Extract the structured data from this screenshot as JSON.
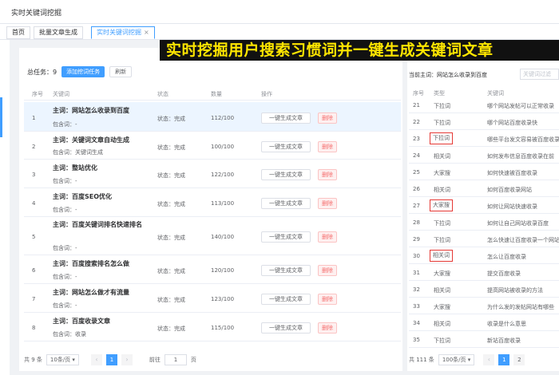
{
  "window_title": "实时关键词挖掘",
  "tabs": [
    {
      "label": "首页"
    },
    {
      "label": "批量文章生成"
    },
    {
      "label": "实时关键词挖掘",
      "close": "×"
    }
  ],
  "banner": "实时挖掘用户搜索习惯词并一键生成关键词文章",
  "toolbar": {
    "total_label": "总任务：",
    "total_count": "9",
    "add_button": "添加挖词任务",
    "refresh_button": "刷新"
  },
  "task_table": {
    "headers": [
      "序号",
      "关键词",
      "状态",
      "数量",
      "操作"
    ],
    "rows": [
      {
        "idx": "1",
        "keyword": "主词：网站怎么收录到百度",
        "include": "包含词：-",
        "status": "状态：完成",
        "count": "112/100",
        "gen": "一键生成文章",
        "del": "删除",
        "selected": true
      },
      {
        "idx": "2",
        "keyword": "主词：关键词文章自动生成",
        "include": "包含词：关键词生成",
        "status": "状态：完成",
        "count": "100/100",
        "gen": "一键生成文章",
        "del": "删除"
      },
      {
        "idx": "3",
        "keyword": "主词：整站优化",
        "include": "包含词：-",
        "status": "状态：完成",
        "count": "122/100",
        "gen": "一键生成文章",
        "del": "删除"
      },
      {
        "idx": "4",
        "keyword": "主词：百度SEO优化",
        "include": "包含词：-",
        "status": "状态：完成",
        "count": "113/100",
        "gen": "一键生成文章",
        "del": "删除"
      },
      {
        "idx": "5",
        "keyword": "主词：百度关键词排名快速排名",
        "include": "包含词：-",
        "status": "状态：完成",
        "count": "140/100",
        "gen": "一键生成文章",
        "del": "删除"
      },
      {
        "idx": "6",
        "keyword": "主词：百度搜索排名怎么做",
        "include": "包含词：-",
        "status": "状态：完成",
        "count": "120/100",
        "gen": "一键生成文章",
        "del": "删除"
      },
      {
        "idx": "7",
        "keyword": "主词：网站怎么做才有流量",
        "include": "包含词：-",
        "status": "状态：完成",
        "count": "123/100",
        "gen": "一键生成文章",
        "del": "删除"
      },
      {
        "idx": "8",
        "keyword": "主词：百度收录文章",
        "include": "包含词：收录",
        "status": "状态：完成",
        "count": "115/100",
        "gen": "一键生成文章",
        "del": "删除"
      }
    ]
  },
  "pager_left": {
    "total": "共 9 条",
    "page_size": "10条/页",
    "prev": "‹",
    "page": "1",
    "next": "›",
    "goto_label": "前往",
    "goto_value": "1",
    "goto_unit": "页"
  },
  "right_panel": {
    "current_label": "当前主词：网站怎么收录到百度",
    "filter_placeholder": "关键词过滤",
    "headers": [
      "序号",
      "类型",
      "关键词"
    ],
    "rows": [
      {
        "n": "21",
        "type": "下拉词",
        "kw": "哪个网站发帖可以正常收录"
      },
      {
        "n": "22",
        "type": "下拉词",
        "kw": "哪个网站百度收录快"
      },
      {
        "n": "23",
        "type": "下拉词",
        "kw": "哪些平台发文容易被百度收录",
        "boxed": true
      },
      {
        "n": "24",
        "type": "相关词",
        "kw": "如何发布信息百度收录在前"
      },
      {
        "n": "25",
        "type": "大家搜",
        "kw": "如何快速被百度收录"
      },
      {
        "n": "26",
        "type": "相关词",
        "kw": "如何百度收录网站"
      },
      {
        "n": "27",
        "type": "大家搜",
        "kw": "如何让网站快速收录",
        "boxed": true
      },
      {
        "n": "28",
        "type": "下拉词",
        "kw": "如何让自己网站收录百度"
      },
      {
        "n": "29",
        "type": "下拉词",
        "kw": "怎么快速让百度收录一个网站"
      },
      {
        "n": "30",
        "type": "相关词",
        "kw": "怎么让百度收录",
        "boxed": true
      },
      {
        "n": "31",
        "type": "大家搜",
        "kw": "提交百度收录"
      },
      {
        "n": "32",
        "type": "相关词",
        "kw": "提高网站被收录的方法"
      },
      {
        "n": "33",
        "type": "大家搜",
        "kw": "为什么发的发帖网站有哪些"
      },
      {
        "n": "34",
        "type": "相关词",
        "kw": "收录是什么意思"
      },
      {
        "n": "35",
        "type": "下拉词",
        "kw": "新站百度收录"
      }
    ]
  },
  "pager_right": {
    "total": "共 111 条",
    "page_size": "100条/页",
    "prev": "‹",
    "page1": "1",
    "page2": "2"
  },
  "colors": {
    "accent": "#409eff",
    "banner_bg": "#111111",
    "banner_text": "#ffe600",
    "highlight_box": "#e53935"
  }
}
